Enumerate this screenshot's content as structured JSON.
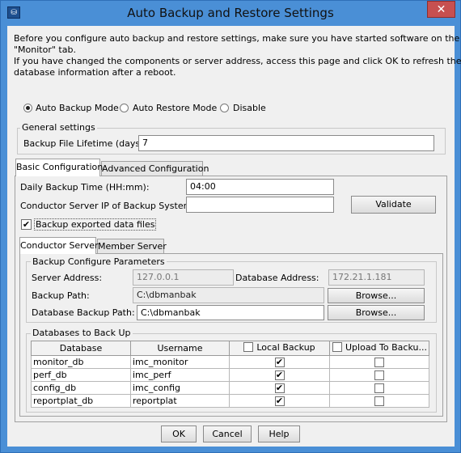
{
  "window": {
    "title": "Auto Backup and Restore Settings",
    "close_glyph": "✕",
    "app_icon": "app-icon"
  },
  "intro": {
    "line1": "Before you configure auto backup and restore settings, make sure you have started software on the",
    "line2": "\"Monitor\" tab.",
    "line3": "If you have changed the components or server address, access this page and click OK to refresh the",
    "line4": "database information after a reboot."
  },
  "mode": {
    "options": [
      {
        "label": "Auto Backup Mode",
        "selected": true
      },
      {
        "label": "Auto Restore Mode",
        "selected": false
      },
      {
        "label": "Disable",
        "selected": false
      }
    ]
  },
  "general": {
    "legend": "General settings",
    "lifetime_label": "Backup File Lifetime (days):",
    "lifetime_value": "7"
  },
  "tabs": {
    "top": [
      "Basic Configuration",
      "Advanced Configuration"
    ],
    "inner": [
      "Conductor Server",
      "Member Server"
    ]
  },
  "basic": {
    "daily_time_label": "Daily Backup Time (HH:mm):",
    "daily_time_value": "04:00",
    "conductor_ip_label": "Conductor Server IP of Backup System:",
    "conductor_ip_value": "",
    "validate_label": "Validate",
    "export_checkbox_label": "Backup exported data files",
    "export_checked": true
  },
  "params": {
    "legend": "Backup Configure Parameters",
    "server_address_label": "Server Address:",
    "server_address_value": "127.0.0.1",
    "database_address_label": "Database Address:",
    "database_address_value": "172.21.1.181",
    "backup_path_label": "Backup Path:",
    "backup_path_value": "C:\\dbmanbak",
    "browse_label": "Browse...",
    "db_backup_path_label": "Database Backup Path:",
    "db_backup_path_value": "C:\\dbmanbak"
  },
  "databases": {
    "legend": "Databases to Back Up",
    "columns": [
      "Database",
      "Username",
      "Local Backup",
      "Upload To Backu..."
    ],
    "rows": [
      {
        "database": "monitor_db",
        "username": "imc_monitor",
        "local": true,
        "upload": false
      },
      {
        "database": "perf_db",
        "username": "imc_perf",
        "local": true,
        "upload": false
      },
      {
        "database": "config_db",
        "username": "imc_config",
        "local": true,
        "upload": false
      },
      {
        "database": "reportplat_db",
        "username": "reportplat",
        "local": true,
        "upload": false
      }
    ]
  },
  "footer": {
    "ok_label": "OK",
    "cancel_label": "Cancel",
    "help_label": "Help"
  },
  "check_glyph": "✔"
}
